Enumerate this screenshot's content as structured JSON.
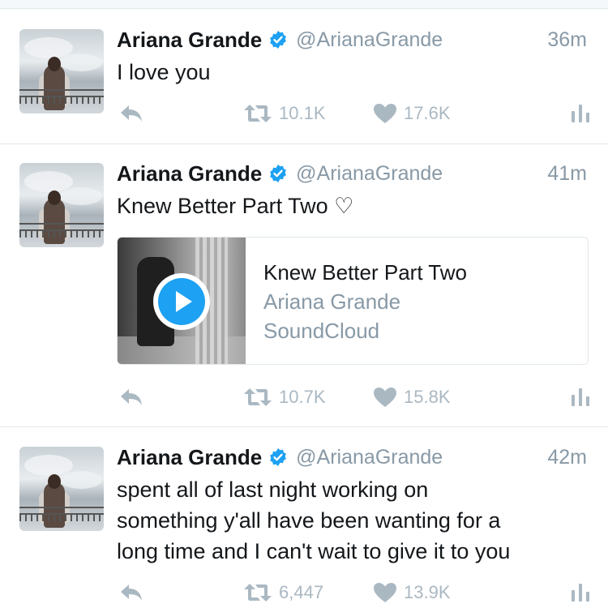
{
  "tweets": [
    {
      "name": "Ariana Grande",
      "handle": "@ArianaGrande",
      "time": "36m",
      "text": "I love you",
      "retweets": "10.1K",
      "likes": "17.6K"
    },
    {
      "name": "Ariana Grande",
      "handle": "@ArianaGrande",
      "time": "41m",
      "text": "Knew Better Part Two ♡",
      "card": {
        "title": "Knew Better Part Two",
        "artist": "Ariana Grande",
        "source": "SoundCloud"
      },
      "retweets": "10.7K",
      "likes": "15.8K"
    },
    {
      "name": "Ariana Grande",
      "handle": "@ArianaGrande",
      "time": "42m",
      "text_lines": [
        "spent all of last night working on",
        "something y'all have been wanting for a",
        "long time and I can't wait to give it to you"
      ],
      "retweets": "6,447",
      "likes": "13.9K"
    }
  ],
  "icons": {
    "verified": "verified-badge-icon",
    "reply": "reply-icon",
    "retweet": "retweet-icon",
    "like": "heart-icon",
    "analytics": "analytics-icon",
    "play": "play-icon"
  },
  "colors": {
    "accent": "#1da1f2",
    "secondary_text": "#8899a6",
    "action_icons": "#aab8c2",
    "divider": "#e1e8ed"
  }
}
